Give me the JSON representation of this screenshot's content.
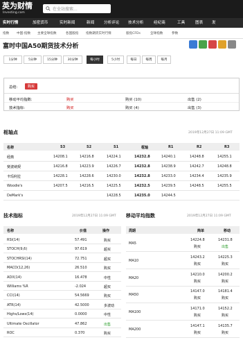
{
  "header": {
    "logo": "英为财情",
    "logo_sub": "Investing.com",
    "search_placeholder": "在全站搜索..."
  },
  "nav": [
    "实时行情",
    "加密货币",
    "实时新闻",
    "新闻",
    "分析评论",
    "技术分析",
    "经纪商",
    "工具",
    "图表",
    "发"
  ],
  "subnav": [
    "指数",
    "中国-指数",
    "主要全球指数",
    "各国股指",
    "指数期货实时行情",
    "股指CFDs",
    "全球指数",
    "参数"
  ],
  "page": {
    "title": "富时中国A50期货技术分析"
  },
  "timeframes": [
    "1分钟",
    "5分钟",
    "15分钟",
    "30分钟",
    "每小时",
    "5小时",
    "每日",
    "每周",
    "每月"
  ],
  "timeframe_active": "每小时",
  "summary": {
    "label": "总结:",
    "badge": "购买",
    "ma_label": "移动平均指数:",
    "ma_value": "购买",
    "buy_label": "购买 (10)",
    "sell_label": "出售 (2)",
    "ti_label": "技术指标:",
    "ti_value": "购买",
    "ti_buy": "购买 (4)",
    "ti_sell": "出售 (3)"
  },
  "pivots": {
    "title": "枢轴点",
    "date": "2019年12月27日 11:09 GMT",
    "headers": [
      "名称",
      "S3",
      "S2",
      "S1",
      "枢轴",
      "R1",
      "R2",
      "R3"
    ],
    "rows": [
      [
        "经典",
        "14208.1",
        "14216.8",
        "14224.1",
        "14232.8",
        "14240.1",
        "14248.8",
        "14255.1"
      ],
      [
        "斐波纳契",
        "14216.8",
        "14223.9",
        "14226.7",
        "14232.8",
        "14238.9",
        "14242.7",
        "14248.8"
      ],
      [
        "卡玛利拉",
        "14228.1",
        "14228.6",
        "14230.0",
        "14232.8",
        "14233.0",
        "14234.4",
        "14235.9"
      ],
      [
        "Woodie's",
        "14207.5",
        "14216.5",
        "14225.5",
        "14232.5",
        "14239.5",
        "14248.5",
        "14255.5"
      ],
      [
        "DeMark's",
        "",
        "",
        "14228.5",
        "14235.0",
        "14244.5",
        "",
        ""
      ]
    ]
  },
  "tech": {
    "title": "技术指标",
    "date": "2019年12月27日 11:09 GMT",
    "headers": [
      "名称",
      "价值",
      "操作"
    ],
    "rows": [
      [
        "RSI(14)",
        "57.491",
        "购买"
      ],
      [
        "STOCH(9,6)",
        "97.619",
        "超买"
      ],
      [
        "STOCHRSI(14)",
        "72.751",
        "超买"
      ],
      [
        "MACD(12,26)",
        "26.510",
        "购买"
      ],
      [
        "ADX(14)",
        "16.478",
        "中性"
      ],
      [
        "Williams %R",
        "-2.024",
        "超买"
      ],
      [
        "CCI(14)",
        "54.5669",
        "购买"
      ],
      [
        "ATR(14)",
        "42.5000",
        "多波动"
      ],
      [
        "Highs/Lows(14)",
        "0.0000",
        "中性"
      ],
      [
        "Ultimate Oscillator",
        "47.862",
        "出售"
      ],
      [
        "ROC",
        "0.370",
        "购买"
      ]
    ]
  },
  "ma": {
    "title": "移动平均指数",
    "date": "2019年12月27日 11:09 GMT",
    "headers": [
      "周期",
      "简单",
      "移动"
    ],
    "rows": [
      [
        "MA5",
        "14224.8",
        "14231.8",
        "购买",
        "出售"
      ],
      [
        "MA10",
        "14243.2",
        "14225.3",
        "购买",
        "购买"
      ],
      [
        "MA20",
        "14210.0",
        "14200.2",
        "购买",
        "购买"
      ],
      [
        "MA50",
        "14147.0",
        "14181.4",
        "购买",
        "购买"
      ],
      [
        "MA100",
        "14171.0",
        "14152.2",
        "购买",
        "购买"
      ],
      [
        "MA200",
        "14147.1",
        "14135.7",
        "购买",
        "购买"
      ]
    ]
  }
}
